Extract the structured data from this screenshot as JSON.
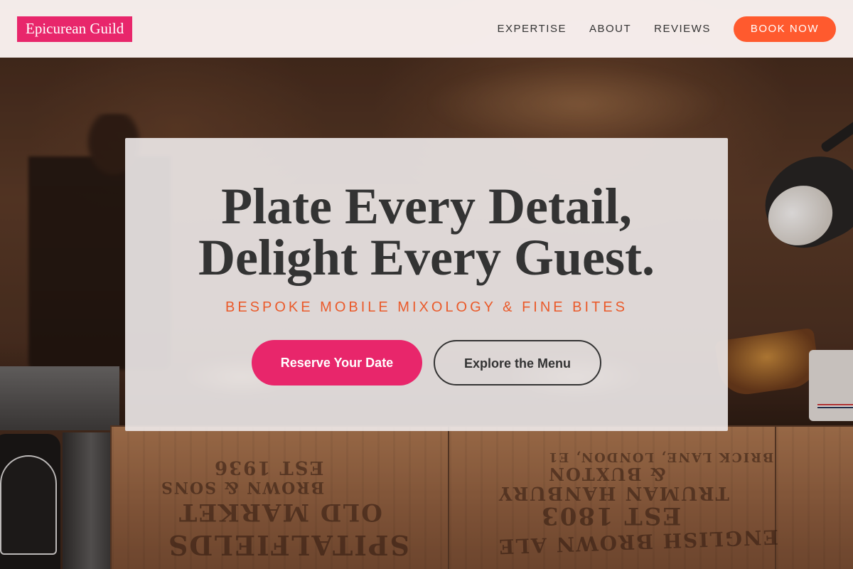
{
  "brand": {
    "name": "Epicurean Guild"
  },
  "nav": {
    "links": [
      {
        "label": "EXPERTISE"
      },
      {
        "label": "ABOUT"
      },
      {
        "label": "REVIEWS"
      }
    ],
    "cta_label": "BOOK NOW"
  },
  "hero": {
    "title_line1": "Plate Every Detail,",
    "title_line2": "Delight Every Guest.",
    "subtitle": "BESPOKE MOBILE MIXOLOGY & FINE BITES",
    "primary_button": "Reserve Your Date",
    "secondary_button": "Explore the Menu"
  },
  "colors": {
    "brand_pink": "#e8266b",
    "accent_orange": "#ff5a2e",
    "subtitle_orange": "#ea5a2a",
    "text_dark": "#333333",
    "header_bg": "#faf2f1"
  },
  "background": {
    "stamps": [
      "EST 1936",
      "BROWN & SONS",
      "OLD MARKET",
      "SPITALFIELDS",
      "BRICK LANE, LONDON, E1",
      "& BUXTON",
      "TRUMAN HANBURY",
      "EST 1803",
      "ENGLISH BROWN ALE"
    ]
  }
}
